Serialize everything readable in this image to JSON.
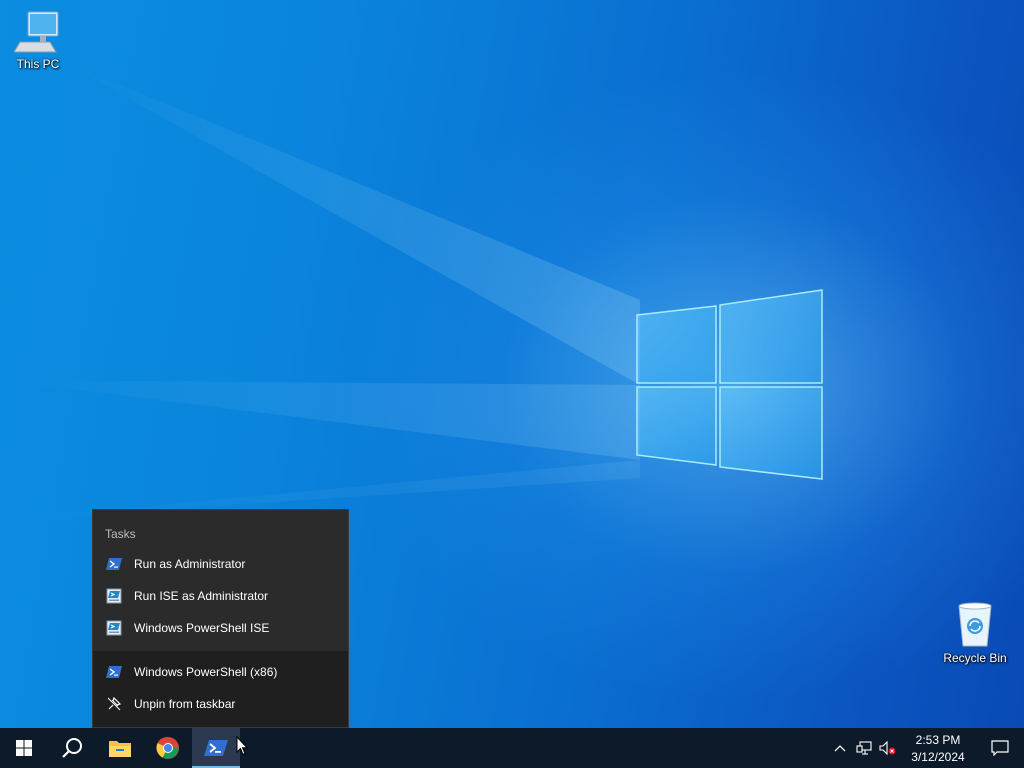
{
  "desktop": {
    "icons": [
      {
        "label": "This PC",
        "icon": "this-pc-icon"
      },
      {
        "label": "Recycle Bin",
        "icon": "recycle-bin-icon"
      }
    ]
  },
  "jumplist": {
    "heading": "Tasks",
    "tasks": [
      {
        "label": "Run as Administrator",
        "icon": "powershell-icon"
      },
      {
        "label": "Run ISE as Administrator",
        "icon": "powershell-ise-icon"
      },
      {
        "label": "Windows PowerShell ISE",
        "icon": "powershell-ise-icon"
      }
    ],
    "actions": [
      {
        "label": "Windows PowerShell (x86)",
        "icon": "powershell-icon"
      },
      {
        "label": "Unpin from taskbar",
        "icon": "unpin-icon"
      }
    ]
  },
  "taskbar": {
    "buttons": [
      "start-icon",
      "search-icon",
      "file-explorer-icon",
      "chrome-icon",
      "powershell-icon"
    ],
    "clock": {
      "time": "2:53 PM",
      "date": "3/12/2024"
    },
    "tray_icons": [
      "chevron-up-icon",
      "network-icon",
      "volume-muted-icon",
      "action-center-icon"
    ]
  },
  "colors": {
    "taskbar_bg": "#0c1a2a",
    "jumplist_bg": "#2b2b2b",
    "accent": "#76b9ed"
  }
}
